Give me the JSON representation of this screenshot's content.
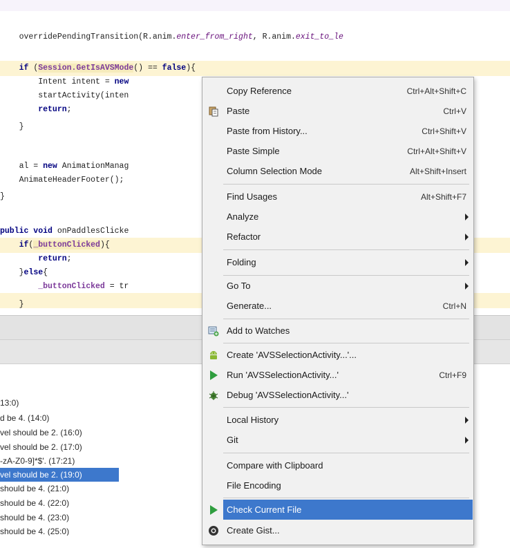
{
  "editor": {
    "code_lines": [
      {
        "pre": "    overridePendingTransition(R.anim.",
        "it1": "enter_from_right",
        "mid": ", R.anim.",
        "it2": "exit_to_le"
      },
      {
        "kw": "    if ",
        "rest_pre": "(",
        "fld": "Session.GetIsAVSMode",
        "rest": "() == ",
        "kw2": "false",
        "tail": "){"
      },
      {
        "text": "        Intent intent = ",
        "kw": "new"
      },
      {
        "text": "        startActivity(inten"
      },
      {
        "kw": "        return",
        "text": ";"
      },
      {
        "text": "    }"
      },
      {
        "text": "    al = ",
        "kw": "new",
        "rest": " AnimationManag"
      },
      {
        "text": "    AnimateHeaderFooter();"
      },
      {
        "text": "}"
      },
      {
        "kw": "public void ",
        "text": "onPaddlesClicke"
      },
      {
        "kw": "    if",
        "pre": "(",
        "fld": "_buttonClicked",
        "post": "){"
      },
      {
        "kw": "        return",
        "text": ";"
      },
      {
        "text": "    }",
        "kw": "else",
        "post": "{"
      },
      {
        "fld": "        _buttonClicked",
        "text": " = tr"
      },
      {
        "text": "    }"
      }
    ]
  },
  "messages": [
    "13:0)",
    "d be 4. (14:0)",
    "vel should be 2. (16:0)",
    "vel should be 2. (17:0)",
    "-zA-Z0-9]*$'. (17:21)",
    "vel should be 2. (19:0)",
    "should be 4. (21:0)",
    "should be 4. (22:0)",
    "should be 4. (23:0)",
    "should be 4. (25:0)"
  ],
  "menu": {
    "items": [
      {
        "label": "Copy Reference",
        "shortcut": "Ctrl+Alt+Shift+C"
      },
      {
        "label": "Paste",
        "shortcut": "Ctrl+V",
        "icon": "paste-icon"
      },
      {
        "label": "Paste from History...",
        "shortcut": "Ctrl+Shift+V"
      },
      {
        "label": "Paste Simple",
        "shortcut": "Ctrl+Alt+Shift+V"
      },
      {
        "label": "Column Selection Mode",
        "shortcut": "Alt+Shift+Insert"
      },
      {
        "label": "Find Usages",
        "shortcut": "Alt+Shift+F7"
      },
      {
        "label": "Analyze",
        "submenu": true
      },
      {
        "label": "Refactor",
        "submenu": true
      },
      {
        "label": "Folding",
        "submenu": true
      },
      {
        "label": "Go To",
        "submenu": true
      },
      {
        "label": "Generate...",
        "shortcut": "Ctrl+N"
      },
      {
        "label": "Add to Watches",
        "icon": "watches-icon"
      },
      {
        "label": "Create 'AVSSelectionActivity...'...",
        "icon": "android-icon"
      },
      {
        "label": "Run 'AVSSelectionActivity...'",
        "shortcut": "Ctrl+F9",
        "icon": "run-icon"
      },
      {
        "label": "Debug 'AVSSelectionActivity...'",
        "icon": "debug-icon"
      },
      {
        "label": "Local History",
        "submenu": true
      },
      {
        "label": "Git",
        "submenu": true
      },
      {
        "label": "Compare with Clipboard"
      },
      {
        "label": "File Encoding"
      },
      {
        "label": "Check Current File",
        "icon": "check-icon",
        "active": true
      },
      {
        "label": "Create Gist...",
        "icon": "github-icon"
      }
    ]
  },
  "colors": {
    "selection": "#3d78cc",
    "menu_bg": "#f1f1f1",
    "highlight": "#fdf4d3"
  }
}
